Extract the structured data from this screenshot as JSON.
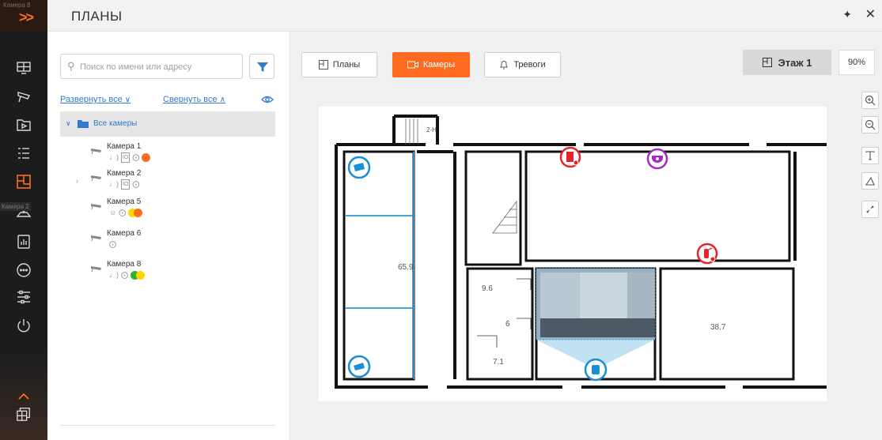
{
  "rail": {
    "top_tag": "Камера 8",
    "side_tag": "Камера 2",
    "items": [
      {
        "icon": "monitor-icon"
      },
      {
        "icon": "camera-icon"
      },
      {
        "icon": "archive-icon"
      },
      {
        "icon": "list-icon"
      },
      {
        "icon": "plans-icon"
      },
      {
        "icon": "map-pin-icon"
      },
      {
        "icon": "reports-icon"
      },
      {
        "icon": "chat-icon"
      },
      {
        "icon": "settings-icon"
      },
      {
        "icon": "power-icon"
      },
      {
        "icon": "layouts-icon"
      }
    ],
    "accent": "#ff6a21"
  },
  "header": {
    "title": "ПЛАНЫ"
  },
  "left": {
    "search_placeholder": "Поиск по имени или адресу",
    "expand_all": "Развернуть все",
    "collapse_all": "Свернуть все",
    "tree_root": "Все камеры",
    "cameras": [
      {
        "name": "Камера 1",
        "status": [
          "mic-icon",
          "io-icon",
          "ptz-icon"
        ],
        "dots": [
          "#ff6a21"
        ]
      },
      {
        "name": "Камера 2",
        "status": [
          "mic-icon",
          "io-icon",
          "ptz-icon"
        ],
        "dots": []
      },
      {
        "name": "Камера 5",
        "status": [
          "face-icon",
          "ptz-icon"
        ],
        "dots": [
          "#ffd700",
          "#ff6a21"
        ]
      },
      {
        "name": "Камера 6",
        "status": [
          "ptz-icon"
        ],
        "dots": []
      },
      {
        "name": "Камера 8",
        "status": [
          "mic-icon",
          "ptz-icon"
        ],
        "dots": [
          "#2bb52b",
          "#ffd700"
        ]
      }
    ]
  },
  "main": {
    "tabs": [
      {
        "label": "Планы",
        "icon": "plans-icon"
      },
      {
        "label": "Камеры",
        "icon": "camera-icon"
      },
      {
        "label": "Тревоги",
        "icon": "bell-icon"
      }
    ],
    "floor_label": "Этаж 1",
    "zoom": "90%",
    "rooms": [
      "65.9",
      "9.6",
      "6",
      "7.1",
      "38.7",
      "2-Н"
    ]
  }
}
